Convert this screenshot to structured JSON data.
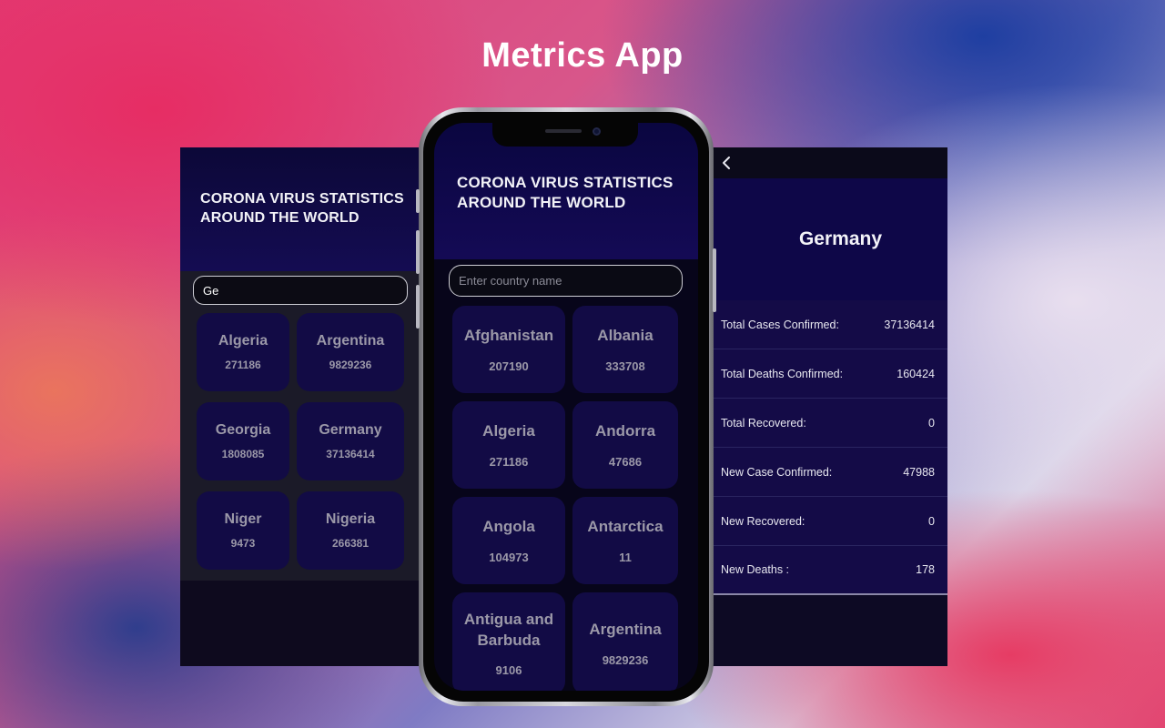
{
  "app_title": "Metrics App",
  "header_title": "CORONA VIRUS STATISTICS AROUND THE WORLD",
  "left_panel": {
    "search_value": "Ge",
    "countries": [
      {
        "name": "Algeria",
        "count": "271186"
      },
      {
        "name": "Argentina",
        "count": "9829236"
      },
      {
        "name": "Georgia",
        "count": "1808085"
      },
      {
        "name": "Germany",
        "count": "37136414"
      },
      {
        "name": "Niger",
        "count": "9473"
      },
      {
        "name": "Nigeria",
        "count": "266381"
      }
    ]
  },
  "phone": {
    "search_placeholder": "Enter country name",
    "countries": [
      {
        "name": "Afghanistan",
        "count": "207190"
      },
      {
        "name": "Albania",
        "count": "333708"
      },
      {
        "name": "Algeria",
        "count": "271186"
      },
      {
        "name": "Andorra",
        "count": "47686"
      },
      {
        "name": "Angola",
        "count": "104973"
      },
      {
        "name": "Antarctica",
        "count": "11"
      },
      {
        "name": "Antigua and Barbuda",
        "count": "9106"
      },
      {
        "name": "Argentina",
        "count": "9829236"
      }
    ]
  },
  "right_panel": {
    "country": "Germany",
    "stats": [
      {
        "label": "Total Cases Confirmed:",
        "value": "37136414"
      },
      {
        "label": "Total Deaths Confirmed:",
        "value": "160424"
      },
      {
        "label": "Total Recovered:",
        "value": "0"
      },
      {
        "label": "New Case Confirmed:",
        "value": "47988"
      },
      {
        "label": "New Recovered:",
        "value": "0"
      },
      {
        "label": "New Deaths :",
        "value": "178"
      }
    ]
  },
  "icons": {
    "back": "chevron-left-icon"
  },
  "colors": {
    "header_bg": "#120a50",
    "card_bg": "#120b45",
    "card_text": "#9b98a8"
  }
}
